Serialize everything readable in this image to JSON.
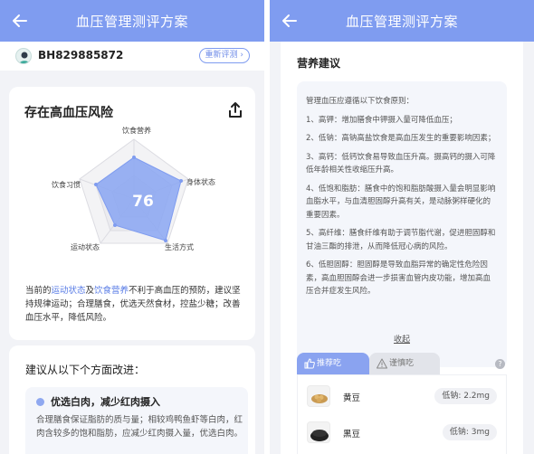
{
  "left": {
    "header": {
      "title": "血压管理测评方案"
    },
    "user": {
      "id": "BH829885872",
      "retest_label": "重新评测"
    },
    "risk": {
      "title": "存在高血压风险",
      "score": "76",
      "radar_labels": {
        "top": "饮食营养",
        "right": "身体状态",
        "bottom_right": "生活方式",
        "bottom_left": "运动状态",
        "left": "饮食习惯"
      },
      "desc_prefix": "当前的",
      "desc_link1": "运动状态",
      "desc_and": "及",
      "desc_link2": "饮食营养",
      "desc_suffix": "不利于高血压的预防，建议坚持规律运动；合理膳食，优选天然食材，控盐少糖；改善血压水平，降低风险。"
    },
    "improve": {
      "title": "建议从以下个方面改进：",
      "tip_title": "优选白肉，减少红肉摄入",
      "tip_text": "合理膳食保证脂肪的质与量；相较鸡鸭鱼虾等白肉，红肉含较多的饱和脂肪，应减少红肉摄入量，优选白肉。"
    }
  },
  "right": {
    "header": {
      "title": "血压管理测评方案"
    },
    "nutrition": {
      "title": "营养建议",
      "advice": [
        "管理血压应遵循以下饮食原则：",
        "1、高钾：增加膳食中钾摄入量可降低血压；",
        "2、低钠：高钠高盐饮食是高血压发生的重要影响因素；",
        "3、高钙：低钙饮食易导致血压升高。摄高钙的摄入可降低年龄相关性收缩压升高。",
        "4、低饱和脂肪：膳食中的饱和脂肪酸摄入量会明显影响血脂水平，与血清胆固醇升高有关，是动脉粥样硬化的重要因素。",
        "5、高纤维：膳食纤维有助于调节脂代谢，促进胆固醇和甘油三酯的排泄，从而降低冠心病的风险。",
        "6、低胆固醇：胆固醇是导致血脂异常的确定性危险因素，高血胆固醇会进一步损害血管内皮功能，增加高血压合并症发生风险。"
      ],
      "collapse_label": "收起",
      "tab_recommend": "推荐吃",
      "tab_caution": "谨慎吃",
      "help_label": "?",
      "foods": [
        {
          "name": "黄豆",
          "badge": "低钠: 2.2mg"
        },
        {
          "name": "黑豆",
          "badge": "低钠: 3mg"
        }
      ]
    }
  },
  "colors": {
    "primary": "#7f9cf0",
    "radar_fill": "#8aa6f2",
    "link": "#5a7de6"
  }
}
